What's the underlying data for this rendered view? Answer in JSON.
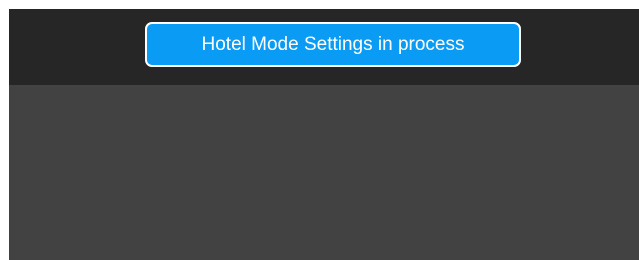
{
  "banner": {
    "text": "Hotel Mode Settings in process",
    "color": "#0a9cf5"
  },
  "colors": {
    "top_bar": "#262626",
    "background": "#424242",
    "banner_border": "#ffffff"
  }
}
